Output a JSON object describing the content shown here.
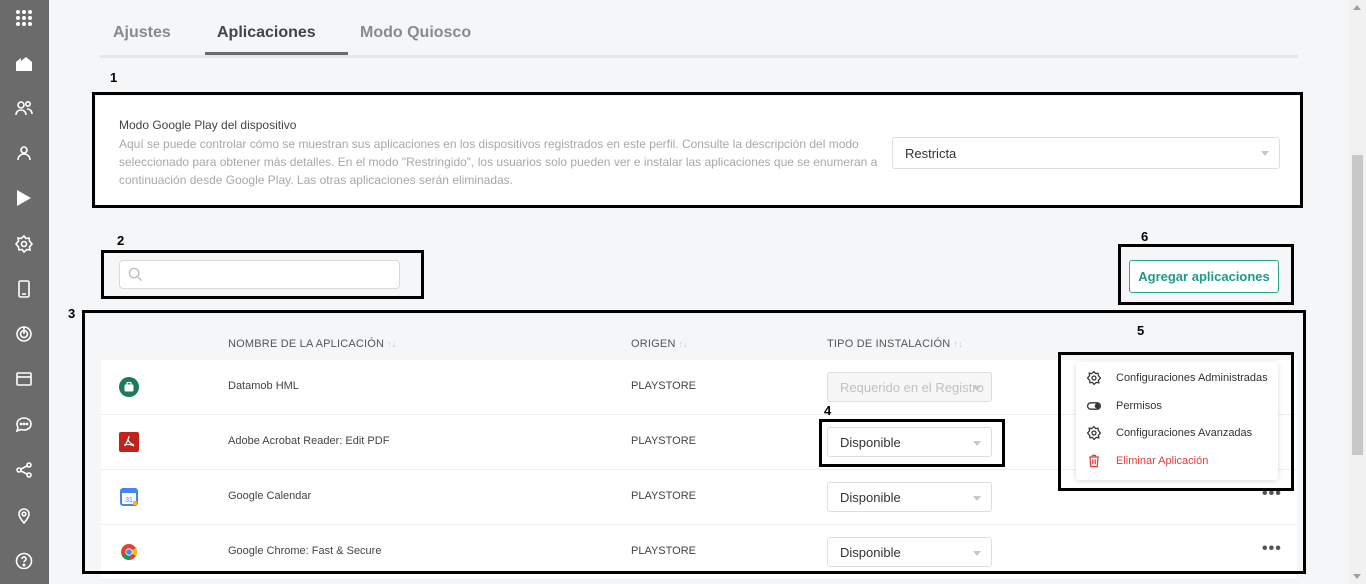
{
  "sidebar": {
    "items": [
      "apps-grid-icon",
      "home-icon",
      "users-icon",
      "user-icon",
      "play-store-icon",
      "settings-icon",
      "device-icon",
      "power-icon",
      "browser-icon",
      "chat-icon",
      "share-icon",
      "location-icon",
      "help-icon"
    ]
  },
  "tabs": [
    {
      "label": "Ajustes",
      "active": false
    },
    {
      "label": "Aplicaciones",
      "active": true
    },
    {
      "label": "Modo Quiosco",
      "active": false
    }
  ],
  "annotations": {
    "n1": "1",
    "n2": "2",
    "n3": "3",
    "n4": "4",
    "n5": "5",
    "n6": "6"
  },
  "google_mode": {
    "title": "Modo Google Play del dispositivo",
    "description": "Aquí se puede controlar cómo se muestran sus aplicaciones en los dispositivos registrados en este perfil. Consulte la descripción del modo seleccionado para obtener más detalles. En el modo \"Restringido\", los usuarios solo pueden ver e instalar las aplicaciones que se enumeran a continuación desde Google Play. Las otras aplicaciones serán eliminadas.",
    "selected": "Restricta"
  },
  "search": {
    "placeholder": ""
  },
  "add_button": "Agregar aplicaciones",
  "table": {
    "headers": {
      "name": "NOMBRE DE LA APLICACIÓN",
      "origin": "ORIGEN",
      "install": "TIPO DE INSTALACIÓN"
    },
    "rows": [
      {
        "name": "Datamob HML",
        "origin": "PLAYSTORE",
        "install": "Requerido en el Registro",
        "icon": "briefcase-icon",
        "disabled": true
      },
      {
        "name": "Adobe Acrobat Reader: Edit PDF",
        "origin": "PLAYSTORE",
        "install": "Disponible",
        "icon": "acrobat-icon",
        "disabled": false
      },
      {
        "name": "Google Calendar",
        "origin": "PLAYSTORE",
        "install": "Disponible",
        "icon": "calendar-icon",
        "disabled": false
      },
      {
        "name": "Google Chrome: Fast & Secure",
        "origin": "PLAYSTORE",
        "install": "Disponible",
        "icon": "chrome-icon",
        "disabled": false
      }
    ]
  },
  "row_menu": {
    "items": [
      {
        "label": "Configuraciones Administradas",
        "icon": "gear-icon"
      },
      {
        "label": "Permisos",
        "icon": "toggle-icon"
      },
      {
        "label": "Configuraciones Avanzadas",
        "icon": "gear-icon"
      },
      {
        "label": "Eliminar Aplicación",
        "icon": "trash-icon",
        "danger": true
      }
    ]
  },
  "colors": {
    "accent": "#1e9b86",
    "sidebar": "#6b6b6b",
    "danger": "#e23b3b"
  }
}
